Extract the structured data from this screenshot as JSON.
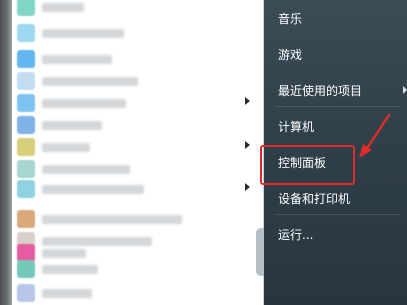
{
  "start_menu": {
    "right_items": [
      {
        "label": "音乐",
        "has_arrow": false
      },
      {
        "label": "游戏",
        "has_arrow": false
      },
      {
        "label": "最近使用的项目",
        "has_arrow": true
      },
      {
        "label": "计算机",
        "has_arrow": false
      },
      {
        "label": "控制面板",
        "has_arrow": false,
        "highlighted": true
      },
      {
        "label": "设备和打印机",
        "has_arrow": false
      },
      {
        "label": "运行...",
        "has_arrow": false
      }
    ],
    "annotation_color": "#e02b2b",
    "programs_blurred": true,
    "program_icon_colors": [
      "#7fd6c4",
      "#9ed8f0",
      "#62b8ee",
      "#c2ddf2",
      "#7cc3f1",
      "#7fb2e6",
      "#9fd7b4",
      "#a6d6cf",
      "#d8cf7a",
      "#8fd2e0",
      "#93c7e8",
      "#d9a97a",
      "#d9d0cc",
      "#e55da0",
      "#76c8b8",
      "#b8c6ea"
    ]
  }
}
